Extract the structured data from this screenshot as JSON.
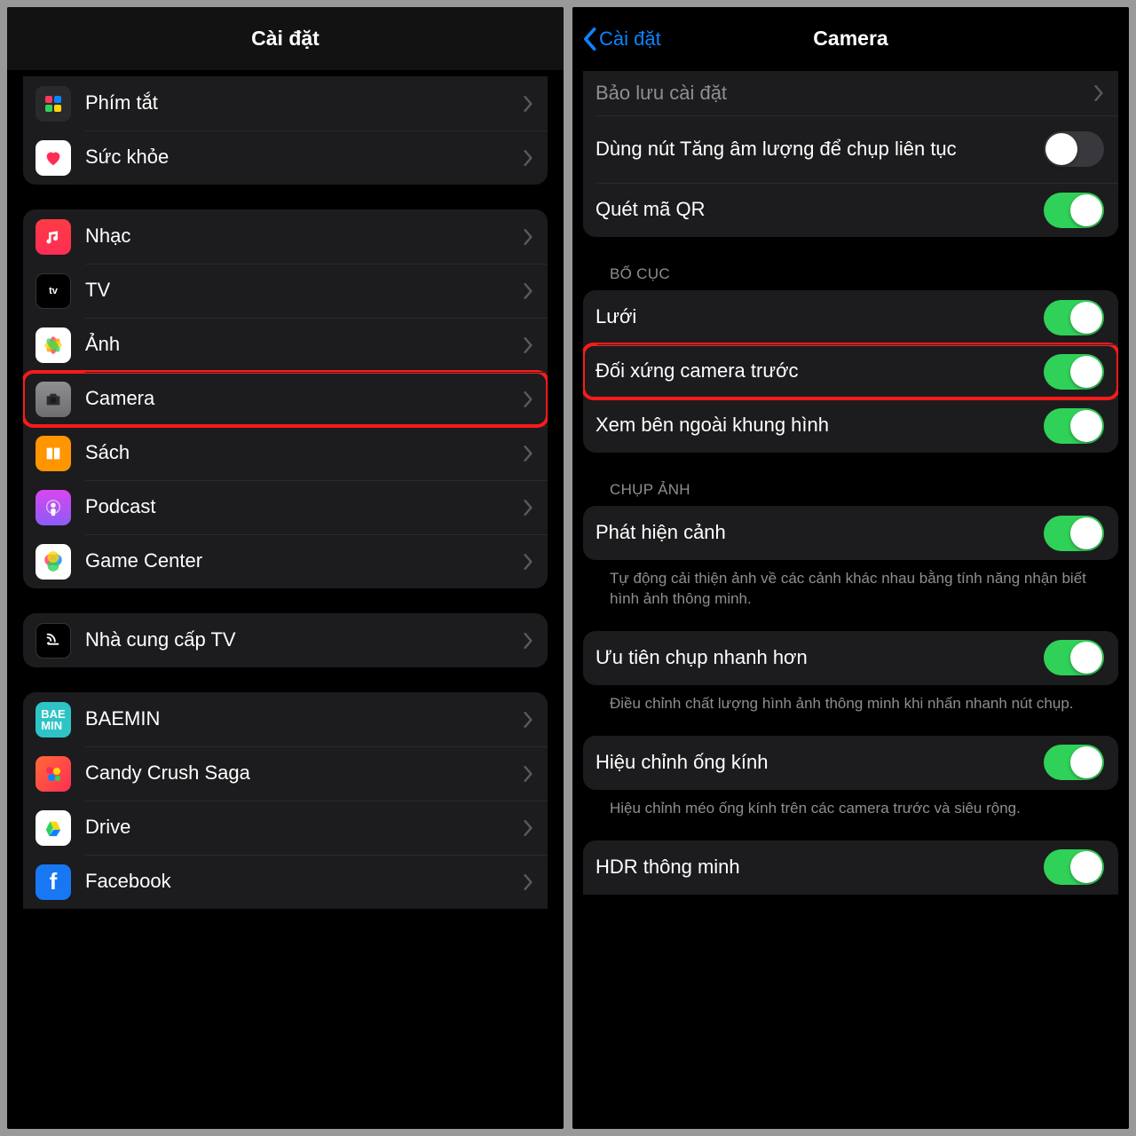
{
  "left": {
    "title": "Cài đặt",
    "groups": [
      {
        "items": [
          {
            "id": "shortcuts",
            "label": "Phím tắt",
            "icon": "shortcuts-icon"
          },
          {
            "id": "health",
            "label": "Sức khỏe",
            "icon": "health-icon"
          }
        ]
      },
      {
        "items": [
          {
            "id": "music",
            "label": "Nhạc",
            "icon": "music-icon"
          },
          {
            "id": "tv",
            "label": "TV",
            "icon": "tv-icon"
          },
          {
            "id": "photos",
            "label": "Ảnh",
            "icon": "photos-icon"
          },
          {
            "id": "camera",
            "label": "Camera",
            "icon": "camera-icon",
            "highlight": true
          },
          {
            "id": "books",
            "label": "Sách",
            "icon": "books-icon"
          },
          {
            "id": "podcast",
            "label": "Podcast",
            "icon": "podcast-icon"
          },
          {
            "id": "gamecenter",
            "label": "Game Center",
            "icon": "gamecenter-icon"
          }
        ]
      },
      {
        "items": [
          {
            "id": "tvprovider",
            "label": "Nhà cung cấp TV",
            "icon": "tvprovider-icon"
          }
        ]
      },
      {
        "items": [
          {
            "id": "baemin",
            "label": "BAEMIN",
            "icon": "baemin-icon"
          },
          {
            "id": "candy",
            "label": "Candy Crush Saga",
            "icon": "candy-icon"
          },
          {
            "id": "drive",
            "label": "Drive",
            "icon": "drive-icon"
          },
          {
            "id": "facebook",
            "label": "Facebook",
            "icon": "facebook-icon"
          }
        ]
      }
    ]
  },
  "right": {
    "title": "Camera",
    "back": "Cài đặt",
    "sections": [
      {
        "header": null,
        "items": [
          {
            "id": "preserve",
            "label": "Bảo lưu cài đặt",
            "type": "nav"
          },
          {
            "id": "volume-burst",
            "label": "Dùng nút Tăng âm lượng để chụp liên tục",
            "type": "toggle",
            "on": false
          },
          {
            "id": "qr",
            "label": "Quét mã QR",
            "type": "toggle",
            "on": true
          }
        ]
      },
      {
        "header": "BỐ CỤC",
        "items": [
          {
            "id": "grid",
            "label": "Lưới",
            "type": "toggle",
            "on": true
          },
          {
            "id": "mirror",
            "label": "Đối xứng camera trước",
            "type": "toggle",
            "on": true,
            "highlight": true
          },
          {
            "id": "outside-frame",
            "label": "Xem bên ngoài khung hình",
            "type": "toggle",
            "on": true
          }
        ]
      },
      {
        "header": "CHỤP ẢNH",
        "items": [
          {
            "id": "scene-detect",
            "label": "Phát hiện cảnh",
            "type": "toggle",
            "on": true
          }
        ],
        "footnote": "Tự động cải thiện ảnh về các cảnh khác nhau bằng tính năng nhận biết hình ảnh thông minh."
      },
      {
        "header": null,
        "items": [
          {
            "id": "fast-shot",
            "label": "Ưu tiên chụp nhanh hơn",
            "type": "toggle",
            "on": true
          }
        ],
        "footnote": "Điều chỉnh chất lượng hình ảnh thông minh khi nhấn nhanh nút chụp."
      },
      {
        "header": null,
        "items": [
          {
            "id": "lens-correction",
            "label": "Hiệu chỉnh ống kính",
            "type": "toggle",
            "on": true
          }
        ],
        "footnote": "Hiệu chỉnh méo ống kính trên các camera trước và siêu rộng."
      },
      {
        "header": null,
        "items": [
          {
            "id": "smart-hdr",
            "label": "HDR thông minh",
            "type": "toggle",
            "on": true
          }
        ]
      }
    ]
  }
}
